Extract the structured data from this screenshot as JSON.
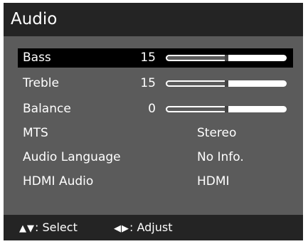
{
  "window": {
    "title": "Audio"
  },
  "menu": {
    "items": [
      {
        "label": "Bass",
        "value": "15",
        "level": 0.5,
        "type": "slider",
        "selected": true
      },
      {
        "label": "Treble",
        "value": "15",
        "level": 0.5,
        "type": "slider",
        "selected": false
      },
      {
        "label": "Balance",
        "value": "0",
        "level": 0.5,
        "type": "slider",
        "selected": false
      },
      {
        "label": "MTS",
        "value": "Stereo",
        "type": "option",
        "selected": false
      },
      {
        "label": "Audio Language",
        "value": "No Info.",
        "type": "option",
        "selected": false
      },
      {
        "label": "HDMI Audio",
        "value": "HDMI",
        "type": "option",
        "selected": false
      }
    ]
  },
  "footer": {
    "select_icon": "▲▼",
    "select_label": ": Select",
    "adjust_icon": "◀▶",
    "adjust_label": ": Adjust"
  },
  "colors": {
    "frame": "#242424",
    "panel": "#5b5b5b",
    "selection": "#000000",
    "text": "#ffffff"
  }
}
